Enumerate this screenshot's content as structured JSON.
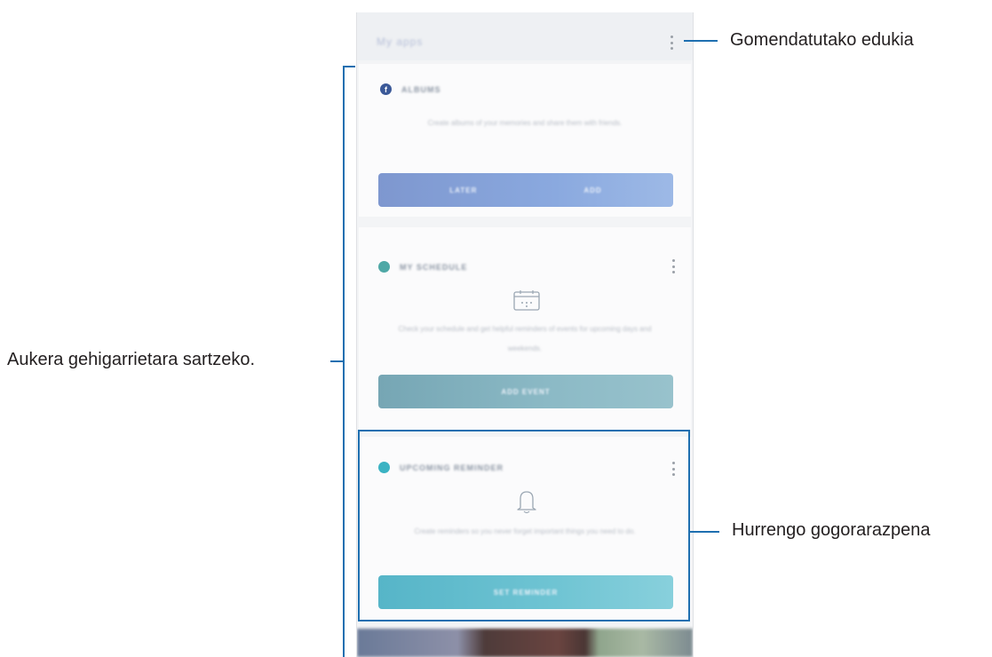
{
  "callouts": {
    "recommended": "Gomendatutako edukia",
    "more_options": "Aukera gehigarrietara sartzeko.",
    "next_reminder": "Hurrengo gogorarazpena"
  },
  "phone": {
    "topbar_title": "My apps",
    "cards": [
      {
        "app": "facebook-icon",
        "title": "ALBUMS",
        "body": "Create albums of your memories and share them with friends.",
        "buttons": [
          "LATER",
          "ADD"
        ],
        "accent": "#8aa9df"
      },
      {
        "app": "calendar-icon",
        "title": "MY SCHEDULE",
        "body": "Check your schedule and get helpful reminders of events for upcoming days and weekends.",
        "buttons": [
          "ADD EVENT"
        ],
        "accent": "#8cbac6"
      },
      {
        "app": "reminder-icon",
        "title": "UPCOMING REMINDER",
        "body": "Create reminders so you never forget important things you need to do.",
        "buttons": [
          "SET REMINDER"
        ],
        "accent": "#6fc4d3"
      }
    ]
  },
  "colors": {
    "callout_line": "#1e6fb0",
    "facebook_blue": "#3b5998",
    "teal": "#4fa8a6",
    "reminder_teal": "#3bb3c3"
  }
}
